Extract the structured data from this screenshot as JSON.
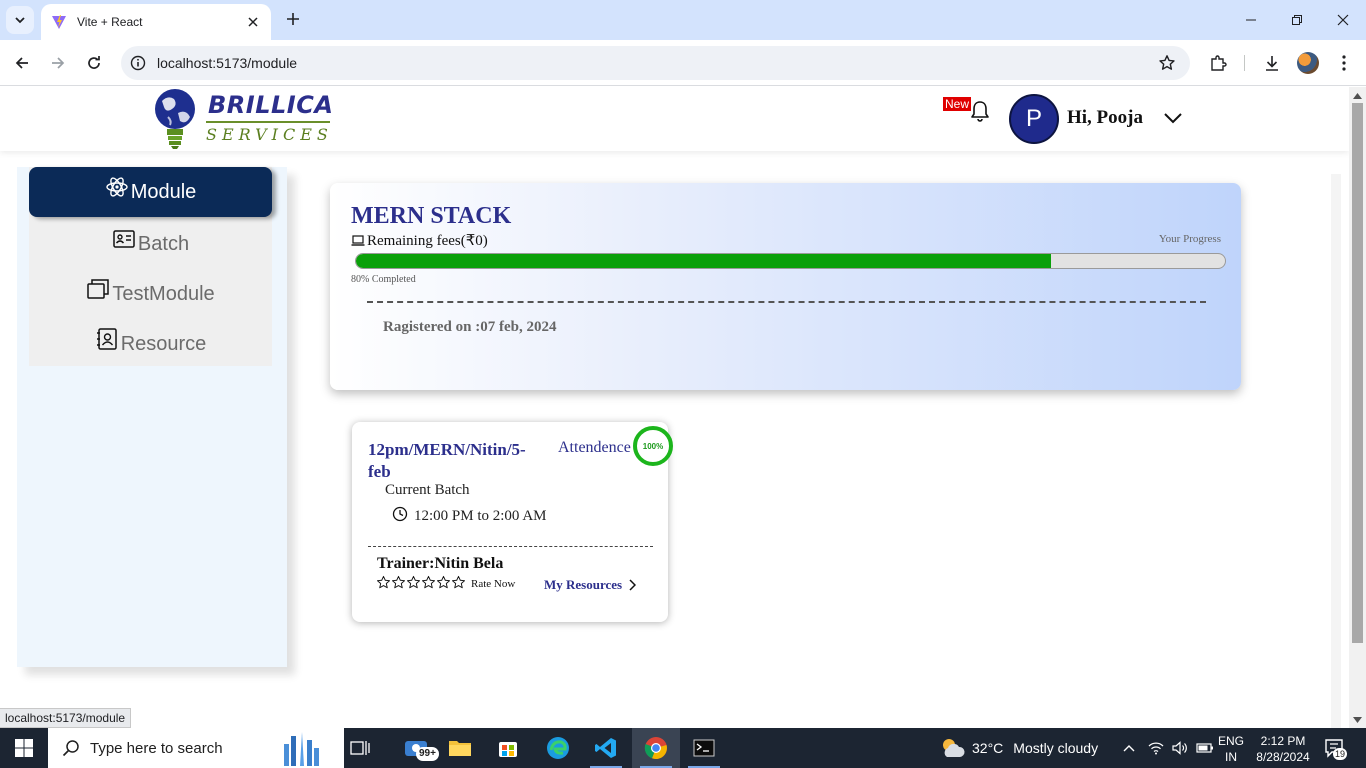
{
  "browser": {
    "tab_title": "Vite + React",
    "url": "localhost:5173/module",
    "status_url": "localhost:5173/module"
  },
  "header": {
    "logo_line1": "BRILLICA",
    "logo_line2": "SERVICES",
    "new_badge": "New",
    "avatar_initial": "P",
    "greeting": "Hi, Pooja"
  },
  "sidebar": {
    "items": [
      {
        "label": "Module",
        "icon": "atom-icon",
        "active": true
      },
      {
        "label": "Batch",
        "icon": "id-card-icon",
        "active": false
      },
      {
        "label": "TestModule",
        "icon": "windows-icon",
        "active": false
      },
      {
        "label": "Resource",
        "icon": "contact-book-icon",
        "active": false
      }
    ]
  },
  "course": {
    "title": "MERN STACK",
    "remaining_fees": "Remaining fees(₹0)",
    "progress_label": "Your Progress",
    "progress_value": 0.8,
    "progress_text": "80% Completed",
    "registered": "Ragistered on :07 feb, 2024",
    "colors": {
      "progress": "#0aa00a",
      "title": "#2c2f8c"
    }
  },
  "batch": {
    "name": "12pm/MERN/Nitin/5-feb",
    "attendance_label": "Attendence",
    "attendance_value": "100%",
    "current_batch": "Current Batch",
    "time": "12:00 PM to 2:00 AM",
    "trainer": "Trainer:Nitin Bela",
    "rate_now": "Rate Now",
    "my_resources": "My Resources",
    "stars_filled": 0,
    "stars_total": 6
  },
  "taskbar": {
    "search_placeholder": "Type here to search",
    "explorer_badge": "99+",
    "weather_temp": "32°C",
    "weather_desc": "Mostly cloudy",
    "lang_1": "ENG",
    "lang_2": "IN",
    "time": "2:12 PM",
    "date": "8/28/2024",
    "notifications": "19"
  }
}
